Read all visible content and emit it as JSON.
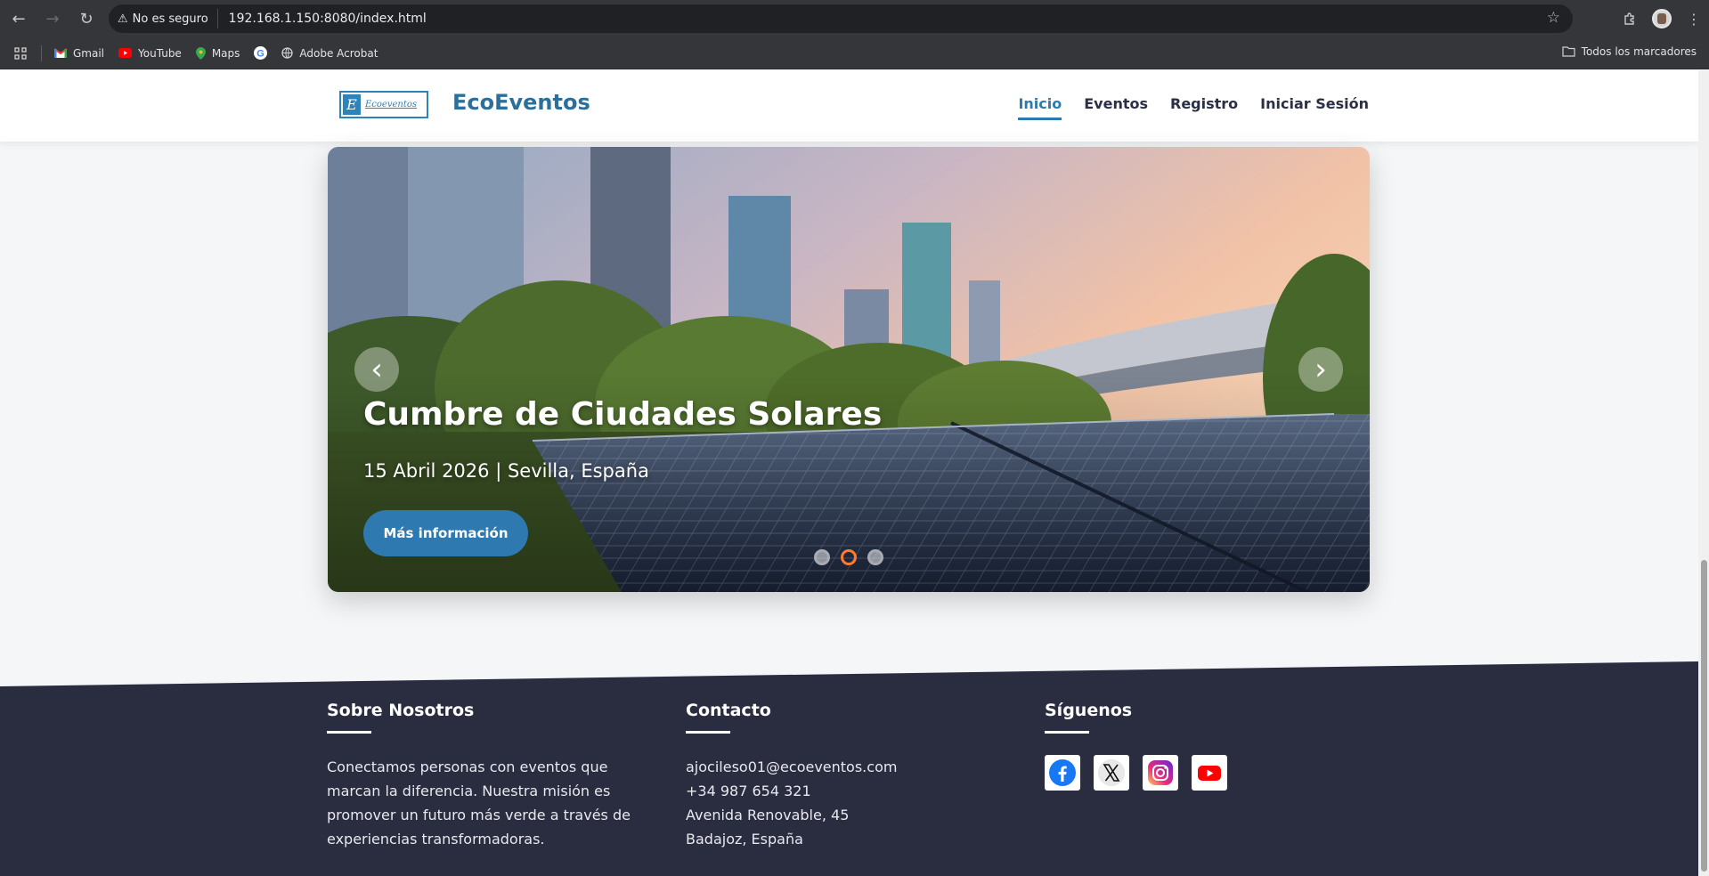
{
  "browser": {
    "security_label": "No es seguro",
    "url": "192.168.1.150:8080/index.html",
    "bookmarks": [
      {
        "label": "Gmail"
      },
      {
        "label": "YouTube"
      },
      {
        "label": "Maps"
      },
      {
        "label": ""
      },
      {
        "label": "Adobe Acrobat"
      }
    ],
    "all_bookmarks_label": "Todos los marcadores"
  },
  "header": {
    "logo_letter": "E",
    "logo_text": "Ecoeventos",
    "brand": "EcoEventos",
    "nav": [
      {
        "label": "Inicio",
        "active": true
      },
      {
        "label": "Eventos",
        "active": false
      },
      {
        "label": "Registro",
        "active": false
      },
      {
        "label": "Iniciar Sesión",
        "active": false
      }
    ]
  },
  "hero": {
    "title": "Cumbre de Ciudades Solares",
    "subtitle": "15 Abril 2026 | Sevilla, España",
    "button_label": "Más información",
    "prev_icon": "‹",
    "next_icon": "›",
    "slides_total": 3,
    "active_slide": 2
  },
  "footer": {
    "about": {
      "title": "Sobre Nosotros",
      "text": "Conectamos personas con eventos que marcan la diferencia. Nuestra misión es promover un futuro más verde a través de experiencias transformadoras."
    },
    "contact": {
      "title": "Contacto",
      "email": "ajocileso01@ecoeventos.com",
      "phone": "+34 987 654 321",
      "address": "Avenida Renovable, 45",
      "city": "Badajoz, España"
    },
    "follow": {
      "title": "Síguenos",
      "icons": [
        "facebook-icon",
        "x-icon",
        "instagram-icon",
        "youtube-icon"
      ]
    }
  },
  "colors": {
    "brand": "#2b6f9a",
    "accent": "#2e7ab0",
    "footer_bg": "#2a2c40",
    "active_dot": "#ff7a2e"
  }
}
